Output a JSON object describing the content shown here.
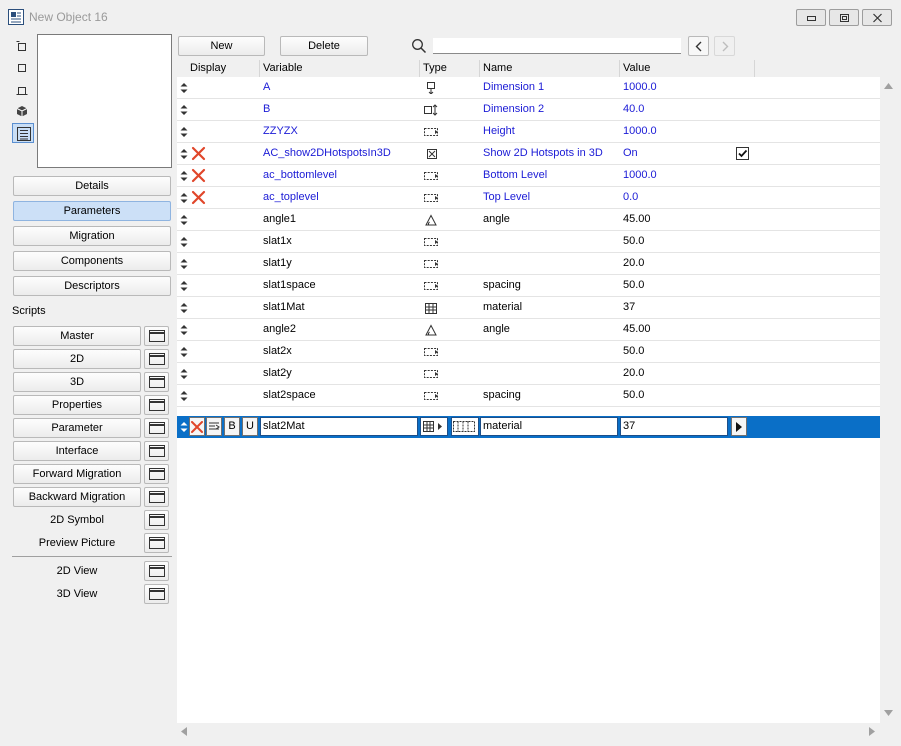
{
  "window": {
    "title": "New Object 16"
  },
  "left_panel": {
    "sections": [
      {
        "label": "Details",
        "selected": false
      },
      {
        "label": "Parameters",
        "selected": true
      },
      {
        "label": "Migration",
        "selected": false
      },
      {
        "label": "Components",
        "selected": false
      },
      {
        "label": "Descriptors",
        "selected": false
      }
    ],
    "scripts_label": "Scripts",
    "scripts": [
      {
        "label": "Master",
        "button": true
      },
      {
        "label": "2D",
        "button": true
      },
      {
        "label": "3D",
        "button": true
      },
      {
        "label": "Properties",
        "button": true
      },
      {
        "label": "Parameter",
        "button": true
      },
      {
        "label": "Interface",
        "button": true
      },
      {
        "label": "Forward Migration",
        "button": true
      },
      {
        "label": "Backward Migration",
        "button": true
      },
      {
        "label": "2D Symbol",
        "button": false
      },
      {
        "label": "Preview Picture",
        "button": false
      }
    ],
    "views": [
      {
        "label": "2D View"
      },
      {
        "label": "3D View"
      }
    ]
  },
  "toolbar": {
    "new_label": "New",
    "delete_label": "Delete",
    "search_value": ""
  },
  "table": {
    "headers": {
      "display": "Display",
      "variable": "Variable",
      "type": "Type",
      "name": "Name",
      "value": "Value"
    },
    "rows": [
      {
        "variable": "A",
        "type": "dimension-a-icon",
        "name": "Dimension 1",
        "value": "1000.0",
        "blue": true,
        "locked": false
      },
      {
        "variable": "B",
        "type": "dimension-b-icon",
        "name": "Dimension 2",
        "value": "40.0",
        "blue": true,
        "locked": false
      },
      {
        "variable": "ZZYZX",
        "type": "length-icon",
        "name": "Height",
        "value": "1000.0",
        "blue": true,
        "locked": false
      },
      {
        "variable": "AC_show2DHotspotsIn3D",
        "type": "boolean-icon",
        "name": "Show 2D Hotspots in 3D",
        "value": "On",
        "blue": true,
        "locked": true,
        "checkbox": true
      },
      {
        "variable": "ac_bottomlevel",
        "type": "length-icon",
        "name": "Bottom Level",
        "value": "1000.0",
        "blue": true,
        "locked": true
      },
      {
        "variable": "ac_toplevel",
        "type": "length-icon",
        "name": "Top Level",
        "value": "0.0",
        "blue": true,
        "locked": true
      },
      {
        "variable": "angle1",
        "type": "angle-icon",
        "name": "angle",
        "value": "45.00",
        "blue": false,
        "locked": false
      },
      {
        "variable": "slat1x",
        "type": "length-icon",
        "name": "",
        "value": "50.0",
        "blue": false,
        "locked": false
      },
      {
        "variable": "slat1y",
        "type": "length-icon",
        "name": "",
        "value": "20.0",
        "blue": false,
        "locked": false
      },
      {
        "variable": "slat1space",
        "type": "length-icon",
        "name": "spacing",
        "value": "50.0",
        "blue": false,
        "locked": false
      },
      {
        "variable": "slat1Mat",
        "type": "material-icon",
        "name": "material",
        "value": "37",
        "blue": false,
        "locked": false
      },
      {
        "variable": "angle2",
        "type": "angle-icon",
        "name": "angle",
        "value": "45.00",
        "blue": false,
        "locked": false
      },
      {
        "variable": "slat2x",
        "type": "length-icon",
        "name": "",
        "value": "50.0",
        "blue": false,
        "locked": false
      },
      {
        "variable": "slat2y",
        "type": "length-icon",
        "name": "",
        "value": "20.0",
        "blue": false,
        "locked": false
      },
      {
        "variable": "slat2space",
        "type": "length-icon",
        "name": "spacing",
        "value": "50.0",
        "blue": false,
        "locked": false
      }
    ],
    "selected_row": {
      "variable": "slat2Mat",
      "name": "material",
      "value": "37",
      "bold_label": "B",
      "underline_label": "U"
    }
  },
  "colors": {
    "selection": "#0a6fc7",
    "builtin_param_text": "#1b1bd6",
    "delete_x": "#e0462a"
  }
}
